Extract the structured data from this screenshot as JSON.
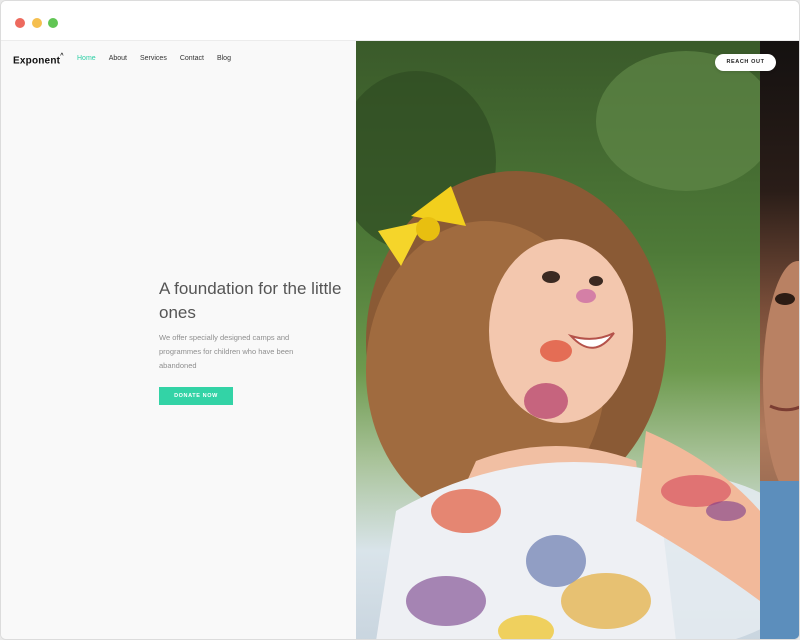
{
  "window": {
    "controls": [
      "close",
      "minimize",
      "maximize"
    ]
  },
  "header": {
    "logo": "Exponent",
    "logo_mark": "^",
    "nav": [
      {
        "label": "Home",
        "active": true
      },
      {
        "label": "About",
        "active": false
      },
      {
        "label": "Services",
        "active": false
      },
      {
        "label": "Contact",
        "active": false
      },
      {
        "label": "Blog",
        "active": false
      }
    ],
    "cta": "REACH OUT"
  },
  "hero": {
    "title": "A foundation for the little ones",
    "description": "We offer specially designed camps and programmes for children who have been abandoned",
    "button": "DONATE NOW"
  },
  "colors": {
    "accent": "#2dcfa5",
    "button": "#33d3a6",
    "left_panel": "#f9f9f9"
  }
}
